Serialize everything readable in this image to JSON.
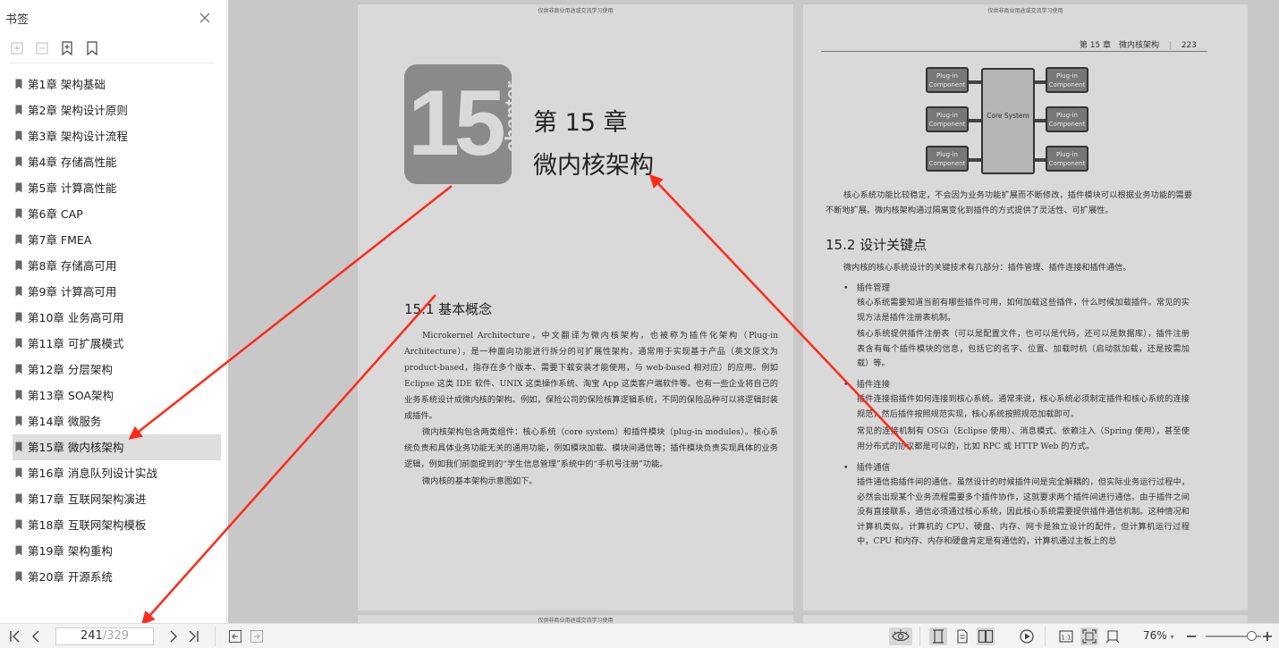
{
  "sidebar": {
    "title": "书签",
    "items": [
      {
        "label": "第1章 架构基础"
      },
      {
        "label": "第2章 架构设计原则"
      },
      {
        "label": "第3章 架构设计流程"
      },
      {
        "label": "第4章 存储高性能"
      },
      {
        "label": "第5章 计算高性能"
      },
      {
        "label": "第6章 CAP"
      },
      {
        "label": "第7章 FMEA"
      },
      {
        "label": "第8章 存储高可用"
      },
      {
        "label": "第9章 计算高可用"
      },
      {
        "label": "第10章 业务高可用"
      },
      {
        "label": "第11章 可扩展模式"
      },
      {
        "label": "第12章 分层架构"
      },
      {
        "label": "第13章 SOA架构"
      },
      {
        "label": "第14章 微服务"
      },
      {
        "label": "第15章 微内核架构",
        "selected": true
      },
      {
        "label": "第16章 消息队列设计实战"
      },
      {
        "label": "第17章 互联网架构演进"
      },
      {
        "label": "第18章 互联网架构模板"
      },
      {
        "label": "第19章 架构重构"
      },
      {
        "label": "第20章 开源系统"
      }
    ]
  },
  "document": {
    "watermark": "仅供非商业用途或交流学习使用",
    "left_page": {
      "chapter_number": "15",
      "chapter_word": "chapter",
      "chapter_title_line1": "第 15 章",
      "chapter_title_line2": "微内核架构",
      "section_heading": "15.1 基本概念",
      "paragraphs": [
        "Microkernel Architecture，中文翻译为微内核架构，也被称为插件化架构（Plug-in Architecture），是一种面向功能进行拆分的可扩展性架构，通常用于实现基于产品（英文原文为 product-based，指存在多个版本、需要下载安装才能使用，与 web-based 相对应）的应用。例如 Eclipse 这类 IDE 软件、UNIX 这类操作系统、淘宝 App 这类客户端软件等。也有一些企业将自己的业务系统设计成微内核的架构。例如，保险公司的保险核算逻辑系统，不同的保险品种可以将逻辑封装成插件。",
        "微内核架构包含两类组件：核心系统（core system）和插件模块（plug-in modules）。核心系统负责和具体业务功能无关的通用功能，例如模块加载、模块间通信等；插件模块负责实现具体的业务逻辑，例如我们前面提到的“学生信息管理”系统中的“手机号注册”功能。",
        "微内核的基本架构示意图如下。"
      ]
    },
    "right_page": {
      "running_head": "第 15 章　微内核架构",
      "page_number": "223",
      "diagram": {
        "plugin_label": "Plug-in Component",
        "core_label": "Core System"
      },
      "intro_paragraph": "核心系统功能比较稳定，不会因为业务功能扩展而不断修改，插件模块可以根据业务功能的需要不断地扩展。微内核架构通过隔离变化到插件的方式提供了灵活性、可扩展性。",
      "section_heading": "15.2 设计关键点",
      "section_intro": "微内核的核心系统设计的关键技术有几部分：插件管理、插件连接和插件通信。",
      "bullets": [
        {
          "title": "插件管理",
          "paragraphs": [
            "核心系统需要知道当前有哪些插件可用，如何加载这些插件，什么时候加载插件。常见的实现方法是插件注册表机制。",
            "核心系统提供插件注册表（可以是配置文件，也可以是代码，还可以是数据库），插件注册表含有每个插件模块的信息，包括它的名字、位置、加载时机（启动就加载，还是按需加载）等。"
          ]
        },
        {
          "title": "插件连接",
          "paragraphs": [
            "插件连接指插件如何连接到核心系统。通常来说，核心系统必须制定插件和核心系统的连接规范，然后插件按照规范实现，核心系统按照规范加载即可。",
            "常见的连接机制有 OSGi（Eclipse 使用）、消息模式、依赖注入（Spring 使用），甚至使用分布式的协议都是可以的，比如 RPC 或 HTTP Web 的方式。"
          ]
        },
        {
          "title": "插件通信",
          "paragraphs": [
            "插件通信指插件间的通信。虽然设计的时候插件间是完全解耦的，但实际业务运行过程中，必然会出现某个业务流程需要多个插件协作，这就要求两个插件间进行通信。由于插件之间没有直接联系，通信必须通过核心系统，因此核心系统需要提供插件通信机制。这种情况和计算机类似，计算机的 CPU、硬盘、内存、网卡是独立设计的配件，但计算机运行过程中，CPU 和内存、内存和硬盘肯定是有通信的，计算机通过主板上的总"
          ]
        }
      ]
    }
  },
  "toolbar": {
    "current_page": "241",
    "total_pages": "/329",
    "zoom": "76%"
  },
  "colors": {
    "arrow": "#ff2a1a",
    "selected_item_bg": "#dedede",
    "viewer_bg": "#c8c8c8",
    "page_bg": "#d9d9d9"
  }
}
